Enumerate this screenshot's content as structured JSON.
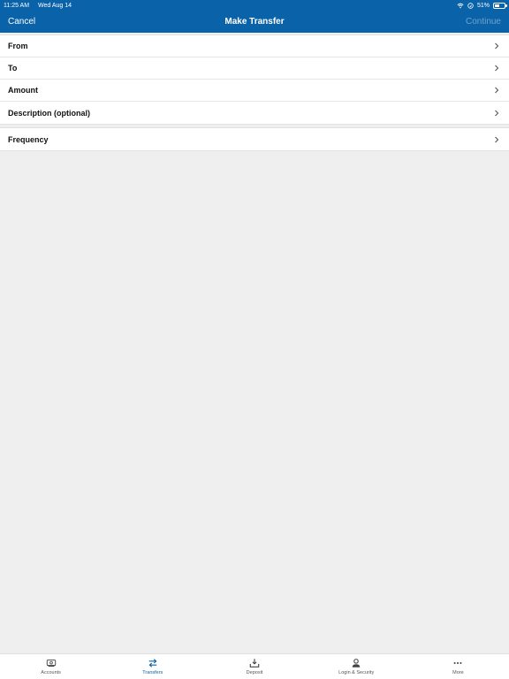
{
  "status": {
    "time": "11:25 AM",
    "date": "Wed Aug 14",
    "battery": "51%",
    "battery_level": 0.51
  },
  "nav": {
    "cancel": "Cancel",
    "title": "Make Transfer",
    "continue": "Continue"
  },
  "form": {
    "rows": [
      {
        "label": "From"
      },
      {
        "label": "To"
      },
      {
        "label": "Amount"
      },
      {
        "label": "Description (optional)"
      }
    ],
    "frequency": {
      "label": "Frequency"
    }
  },
  "tabs": [
    {
      "label": "Accounts",
      "icon": "accounts-icon"
    },
    {
      "label": "Transfers",
      "icon": "transfers-icon"
    },
    {
      "label": "Deposit",
      "icon": "deposit-icon"
    },
    {
      "label": "Login & Security",
      "icon": "person-icon"
    },
    {
      "label": "More",
      "icon": "more-icon"
    }
  ],
  "colors": {
    "brand": "#0a62a8",
    "background": "#efefef",
    "continue_disabled": "#6fa3cf"
  }
}
